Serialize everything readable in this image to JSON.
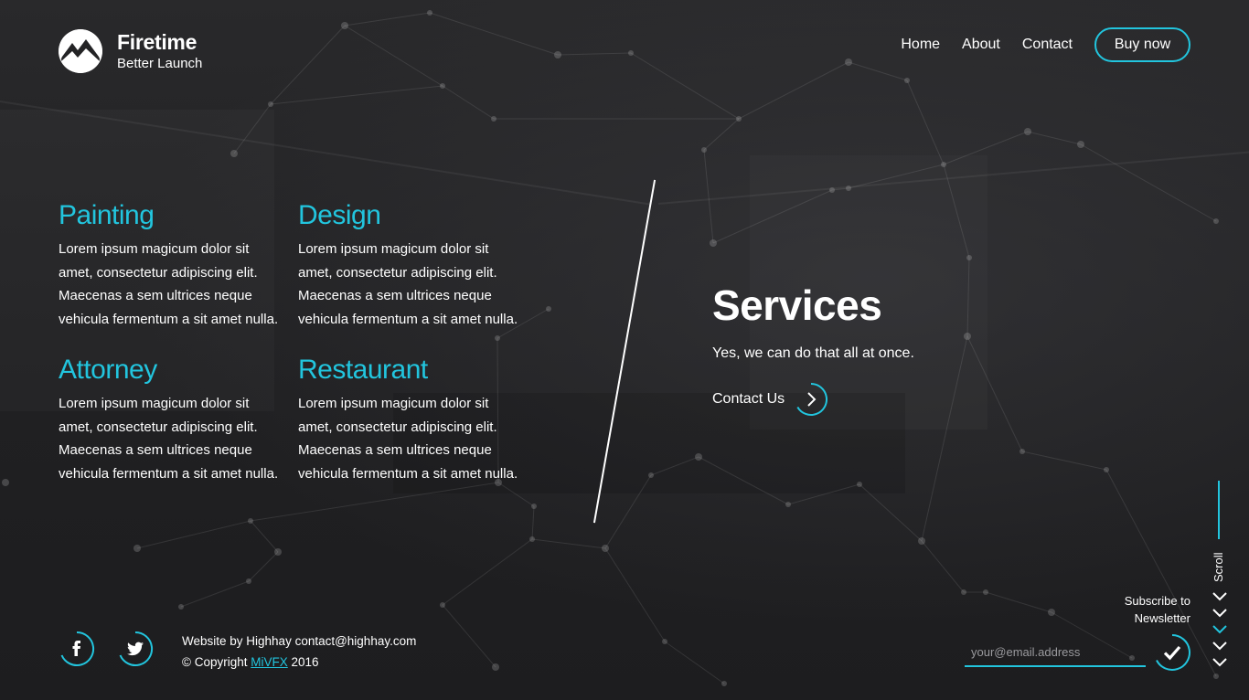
{
  "brand": {
    "title": "Firetime",
    "subtitle": "Better Launch"
  },
  "nav": {
    "items": [
      "Home",
      "About",
      "Contact"
    ],
    "cta": "Buy now"
  },
  "services": [
    {
      "title": "Painting",
      "body": "Lorem ipsum magicum dolor sit amet, consectetur adipiscing elit. Maecenas a sem ultrices neque vehicula fermentum a sit amet nulla."
    },
    {
      "title": "Design",
      "body": "Lorem ipsum magicum dolor sit amet, consectetur adipiscing elit. Maecenas a sem ultrices neque vehicula fermentum a sit amet nulla."
    },
    {
      "title": "Attorney",
      "body": "Lorem ipsum magicum dolor sit amet, consectetur adipiscing elit. Maecenas a sem ultrices neque vehicula fermentum a sit amet nulla."
    },
    {
      "title": "Restaurant",
      "body": "Lorem ipsum magicum dolor sit amet, consectetur adipiscing elit. Maecenas a sem ultrices neque vehicula fermentum a sit amet nulla."
    }
  ],
  "hero": {
    "title": "Services",
    "subtitle": "Yes, we can do that all at once.",
    "cta": "Contact Us"
  },
  "footer": {
    "credit": "Website by Highhay contact@highhay.com",
    "copyright_prefix": "© Copyright",
    "copyright_link": "MiVFX",
    "copyright_year": "2016",
    "social_icons": [
      "facebook-icon",
      "twitter-icon"
    ]
  },
  "newsletter": {
    "label_line1": "Subscribe to",
    "label_line2": "Newsletter",
    "placeholder": "your@email.address"
  },
  "scroll": {
    "label": "Scroll"
  },
  "colors": {
    "accent": "#22c5de",
    "background": "#232325",
    "text": "#ffffff"
  }
}
